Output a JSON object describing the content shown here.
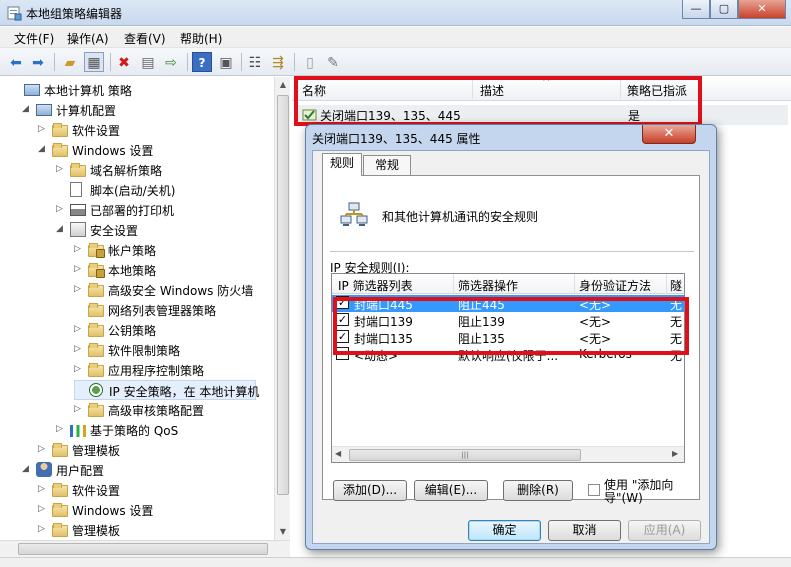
{
  "window": {
    "title": "本地组策略编辑器",
    "min": "—",
    "max": "▢",
    "close": "✕"
  },
  "menu": [
    "文件(F)",
    "操作(A)",
    "查看(V)",
    "帮助(H)"
  ],
  "toolbar_icons": [
    "back-arrow-icon",
    "forward-arrow-icon",
    "up-folder-icon",
    "show-tree-icon",
    "delete-icon",
    "properties-icon",
    "export-icon",
    "help-icon",
    "view-icon",
    "create-policy-icon",
    "assign-icon",
    "manage-filters-icon",
    "edit-icon"
  ],
  "tree": [
    {
      "label": "本地计算机 策略",
      "level": 0,
      "expander": "",
      "icon": "computer-policy-icon"
    },
    {
      "label": "计算机配置",
      "level": 1,
      "expander": "◢",
      "icon": "computer-icon"
    },
    {
      "label": "软件设置",
      "level": 2,
      "expander": "▷",
      "icon": "folder-icon"
    },
    {
      "label": "Windows 设置",
      "level": 2,
      "expander": "◢",
      "icon": "folder-icon"
    },
    {
      "label": "域名解析策略",
      "level": 3,
      "expander": "▷",
      "icon": "folder-icon"
    },
    {
      "label": "脚本(启动/关机)",
      "level": 3,
      "expander": "",
      "icon": "script-icon"
    },
    {
      "label": "已部署的打印机",
      "level": 3,
      "expander": "▷",
      "icon": "printer-icon"
    },
    {
      "label": "安全设置",
      "level": 3,
      "expander": "◢",
      "icon": "security-icon"
    },
    {
      "label": "帐户策略",
      "level": 4,
      "expander": "▷",
      "icon": "lock-folder-icon"
    },
    {
      "label": "本地策略",
      "level": 4,
      "expander": "▷",
      "icon": "lock-folder-icon"
    },
    {
      "label": "高级安全 Windows 防火墙",
      "level": 4,
      "expander": "▷",
      "icon": "folder-icon"
    },
    {
      "label": "网络列表管理器策略",
      "level": 4,
      "expander": "",
      "icon": "folder-icon"
    },
    {
      "label": "公钥策略",
      "level": 4,
      "expander": "▷",
      "icon": "folder-icon"
    },
    {
      "label": "软件限制策略",
      "level": 4,
      "expander": "▷",
      "icon": "folder-icon"
    },
    {
      "label": "应用程序控制策略",
      "level": 4,
      "expander": "▷",
      "icon": "folder-icon"
    },
    {
      "label": "IP 安全策略，在 本地计算机",
      "level": 4,
      "expander": "",
      "icon": "ip-security-icon",
      "selected": true
    },
    {
      "label": "高级审核策略配置",
      "level": 4,
      "expander": "▷",
      "icon": "folder-icon"
    },
    {
      "label": "基于策略的 QoS",
      "level": 3,
      "expander": "▷",
      "icon": "qos-chart-icon"
    },
    {
      "label": "管理模板",
      "level": 2,
      "expander": "▷",
      "icon": "folder-icon"
    },
    {
      "label": "用户配置",
      "level": 1,
      "expander": "◢",
      "icon": "user-icon"
    },
    {
      "label": "软件设置",
      "level": 2,
      "expander": "▷",
      "icon": "folder-icon"
    },
    {
      "label": "Windows 设置",
      "level": 2,
      "expander": "▷",
      "icon": "folder-icon"
    },
    {
      "label": "管理模板",
      "level": 2,
      "expander": "▷",
      "icon": "folder-icon"
    }
  ],
  "list": {
    "columns": [
      "名称",
      "描述",
      "策略已指派"
    ],
    "sort_indicator": "^",
    "rows": [
      {
        "name": "关闭端口139、135、445",
        "description": "",
        "assigned": "是"
      }
    ]
  },
  "dialog": {
    "title": "关闭端口139、135、445 属性",
    "close": "✕",
    "tabs": [
      "规则",
      "常规"
    ],
    "description": "和其他计算机通讯的安全规则",
    "rules_label": "IP 安全规则(I):",
    "columns": [
      "IP 筛选器列表",
      "筛选器操作",
      "身份验证方法",
      "隧"
    ],
    "rules": [
      {
        "checked": true,
        "filter": "封端口445",
        "action": "阻止445",
        "auth": "<无>",
        "tunnel": "无",
        "highlight": true
      },
      {
        "checked": true,
        "filter": "封端口139",
        "action": "阻止139",
        "auth": "<无>",
        "tunnel": "无",
        "highlight": false
      },
      {
        "checked": true,
        "filter": "封端口135",
        "action": "阻止135",
        "auth": "<无>",
        "tunnel": "无",
        "highlight": false
      },
      {
        "checked": false,
        "filter": "<动态>",
        "action": "默认响应(仅限于...",
        "auth": "Kerberos",
        "tunnel": "无",
        "highlight": false
      }
    ],
    "scroll_grip": "|||",
    "buttons": {
      "add": "添加(D)...",
      "edit": "编辑(E)...",
      "remove": "删除(R)",
      "wizard": "使用 \"添加向导\"(W)"
    },
    "footer": {
      "ok": "确定",
      "cancel": "取消",
      "apply": "应用(A)"
    }
  },
  "colors": {
    "highlight": "#e0101a",
    "selection": "#3399ff",
    "titlebar": "#c9d9ee"
  }
}
